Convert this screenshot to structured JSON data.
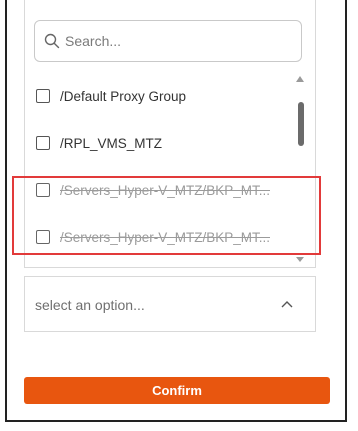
{
  "search": {
    "placeholder": "Search...",
    "icon": "search-icon"
  },
  "options": [
    {
      "label": "/Default Proxy Group",
      "checked": false,
      "struck": false
    },
    {
      "label": "/RPL_VMS_MTZ",
      "checked": false,
      "struck": false
    },
    {
      "label": "/Servers_Hyper-V_MTZ/BKP_MT...",
      "checked": false,
      "struck": true
    },
    {
      "label": "/Servers_Hyper-V_MTZ/BKP_MT...",
      "checked": false,
      "struck": true
    }
  ],
  "select": {
    "placeholder": "select an option...",
    "icon": "chevron-up-icon"
  },
  "confirm": {
    "label": "Confirm"
  },
  "colors": {
    "accent": "#e8560f",
    "highlight": "#e23a3a"
  }
}
